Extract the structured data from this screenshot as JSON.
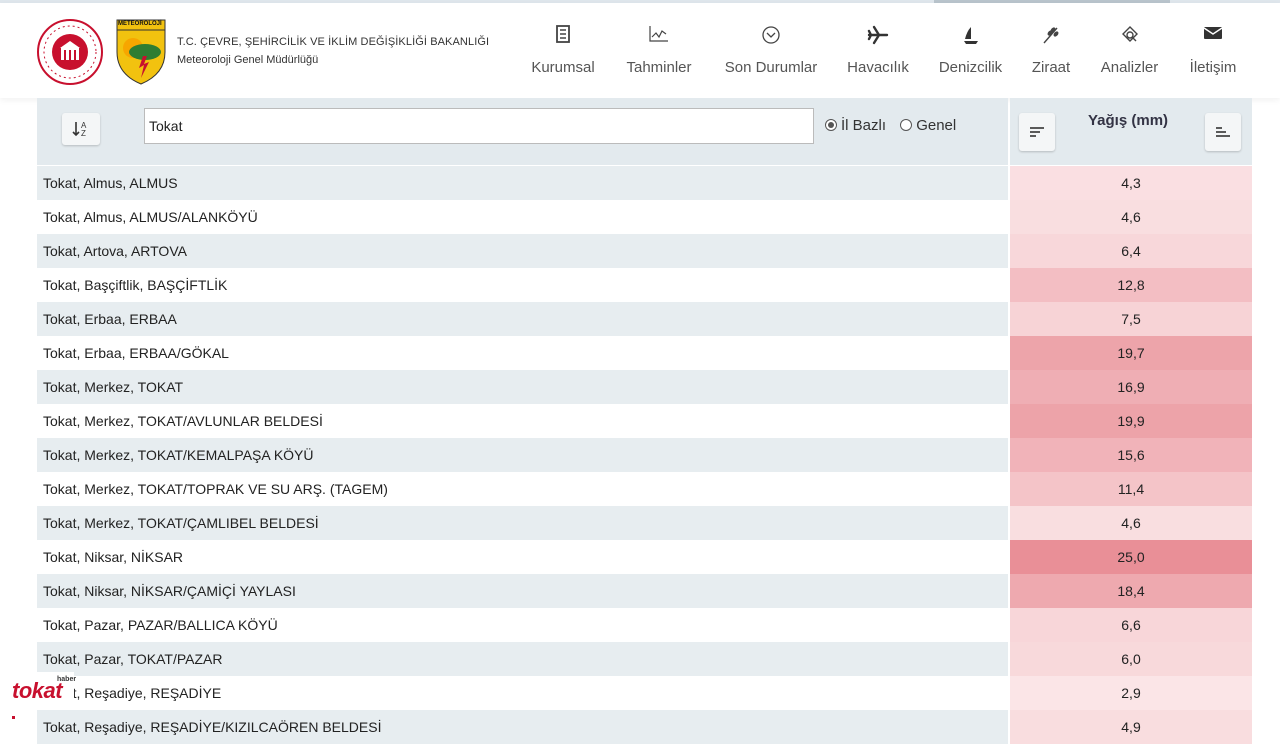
{
  "header": {
    "ministry_line": "T.C. ÇEVRE, ŞEHİRCİLİK VE İKLİM DEĞİŞİKLİĞİ BAKANLIĞI",
    "department_line": "Meteoroloji Genel Müdürlüğü",
    "badge_text": "METEOROLOJİ"
  },
  "nav": [
    {
      "label": "Kurumsal",
      "icon": "document-icon"
    },
    {
      "label": "Tahminler",
      "icon": "chart-line-icon"
    },
    {
      "label": "Son Durumlar",
      "icon": "circle-chevron-icon"
    },
    {
      "label": "Havacılık",
      "icon": "airplane-icon"
    },
    {
      "label": "Denizcilik",
      "icon": "sailboat-icon"
    },
    {
      "label": "Ziraat",
      "icon": "wheat-icon"
    },
    {
      "label": "Analizler",
      "icon": "analysis-icon"
    },
    {
      "label": "İletişim",
      "icon": "envelope-icon"
    }
  ],
  "toolbar": {
    "search_value": "Tokat",
    "radio_il": "İl Bazlı",
    "radio_genel": "Genel",
    "selected_radio": "il",
    "column_title": "Yağış (mm)"
  },
  "rows": [
    {
      "name": "Tokat, Almus, ALMUS",
      "value": "4,3"
    },
    {
      "name": "Tokat, Almus, ALMUS/ALANKÖYÜ",
      "value": "4,6"
    },
    {
      "name": "Tokat, Artova, ARTOVA",
      "value": "6,4"
    },
    {
      "name": "Tokat, Başçiftlik, BAŞÇİFTLİK",
      "value": "12,8"
    },
    {
      "name": "Tokat, Erbaa, ERBAA",
      "value": "7,5"
    },
    {
      "name": "Tokat, Erbaa, ERBAA/GÖKAL",
      "value": "19,7"
    },
    {
      "name": "Tokat, Merkez, TOKAT",
      "value": "16,9"
    },
    {
      "name": "Tokat, Merkez, TOKAT/AVLUNLAR BELDESİ",
      "value": "19,9"
    },
    {
      "name": "Tokat, Merkez, TOKAT/KEMALPAŞA KÖYÜ",
      "value": "15,6"
    },
    {
      "name": "Tokat, Merkez, TOKAT/TOPRAK VE SU ARŞ. (TAGEM)",
      "value": "11,4"
    },
    {
      "name": "Tokat, Merkez, TOKAT/ÇAMLIBEL BELDESİ",
      "value": "4,6"
    },
    {
      "name": "Tokat, Niksar, NİKSAR",
      "value": "25,0"
    },
    {
      "name": "Tokat, Niksar, NİKSAR/ÇAMİÇİ YAYLASI",
      "value": "18,4"
    },
    {
      "name": "Tokat, Pazar, PAZAR/BALLICA KÖYÜ",
      "value": "6,6"
    },
    {
      "name": "Tokat, Pazar, TOKAT/PAZAR",
      "value": "6,0"
    },
    {
      "name": "Tokat, Reşadiye, REŞADİYE",
      "value": "2,9"
    },
    {
      "name": "Tokat, Reşadiye, REŞADİYE/KIZILCAÖREN BELDESİ",
      "value": "4,9"
    }
  ],
  "watermark": {
    "brand": "tokat",
    "sub": "haber"
  },
  "colors": {
    "heat_base": "#e88a93",
    "row_stripe": "#e7edf0",
    "brand_red": "#c8102e"
  }
}
